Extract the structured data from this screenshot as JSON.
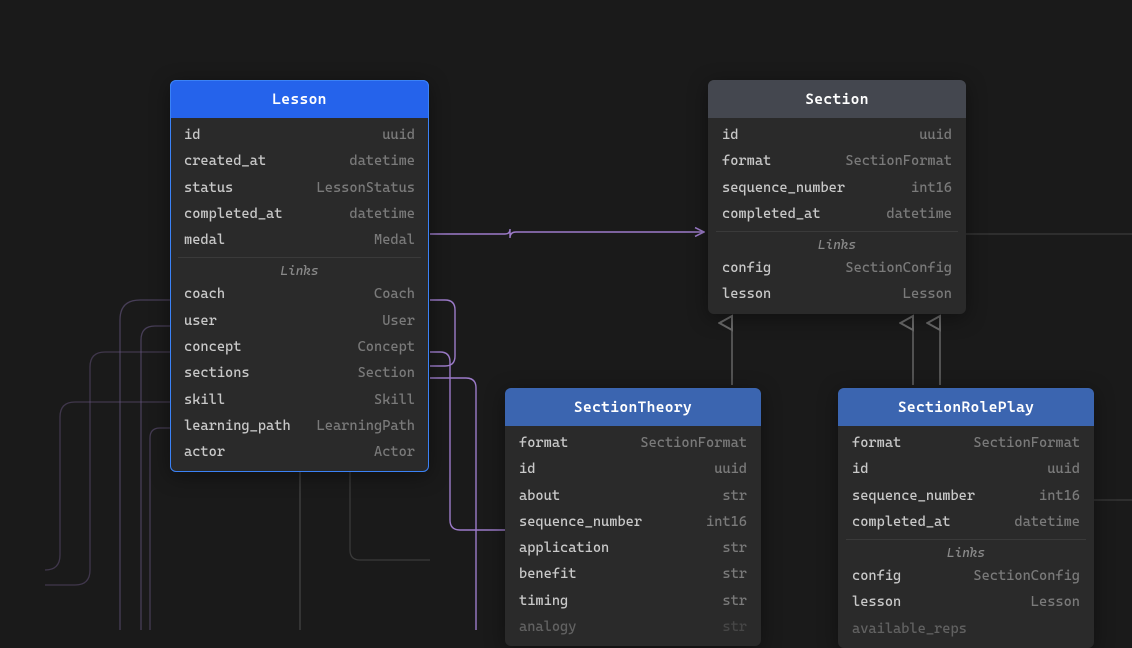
{
  "entities": {
    "lesson": {
      "title": "Lesson",
      "fields": [
        {
          "name": "id",
          "type": "uuid"
        },
        {
          "name": "created_at",
          "type": "datetime"
        },
        {
          "name": "status",
          "type": "LessonStatus"
        },
        {
          "name": "completed_at",
          "type": "datetime"
        },
        {
          "name": "medal",
          "type": "Medal"
        }
      ],
      "links_label": "Links",
      "links": [
        {
          "name": "coach",
          "type": "Coach"
        },
        {
          "name": "user",
          "type": "User"
        },
        {
          "name": "concept",
          "type": "Concept"
        },
        {
          "name": "sections",
          "type": "Section"
        },
        {
          "name": "skill",
          "type": "Skill"
        },
        {
          "name": "learning_path",
          "type": "LearningPath"
        },
        {
          "name": "actor",
          "type": "Actor"
        }
      ]
    },
    "section": {
      "title": "Section",
      "fields": [
        {
          "name": "id",
          "type": "uuid"
        },
        {
          "name": "format",
          "type": "SectionFormat"
        },
        {
          "name": "sequence_number",
          "type": "int16"
        },
        {
          "name": "completed_at",
          "type": "datetime"
        }
      ],
      "links_label": "Links",
      "links": [
        {
          "name": "config",
          "type": "SectionConfig"
        },
        {
          "name": "lesson",
          "type": "Lesson"
        }
      ]
    },
    "sectionTheory": {
      "title": "SectionTheory",
      "fields": [
        {
          "name": "format",
          "type": "SectionFormat"
        },
        {
          "name": "id",
          "type": "uuid"
        },
        {
          "name": "about",
          "type": "str"
        },
        {
          "name": "sequence_number",
          "type": "int16"
        },
        {
          "name": "application",
          "type": "str"
        },
        {
          "name": "benefit",
          "type": "str"
        },
        {
          "name": "timing",
          "type": "str"
        },
        {
          "name": "analogy",
          "type": "str"
        }
      ]
    },
    "sectionRolePlay": {
      "title": "SectionRolePlay",
      "fields": [
        {
          "name": "format",
          "type": "SectionFormat"
        },
        {
          "name": "id",
          "type": "uuid"
        },
        {
          "name": "sequence_number",
          "type": "int16"
        },
        {
          "name": "completed_at",
          "type": "datetime"
        }
      ],
      "links_label": "Links",
      "links": [
        {
          "name": "config",
          "type": "SectionConfig"
        },
        {
          "name": "lesson",
          "type": "Lesson"
        },
        {
          "name": "available_reps",
          "type": ""
        }
      ]
    }
  }
}
